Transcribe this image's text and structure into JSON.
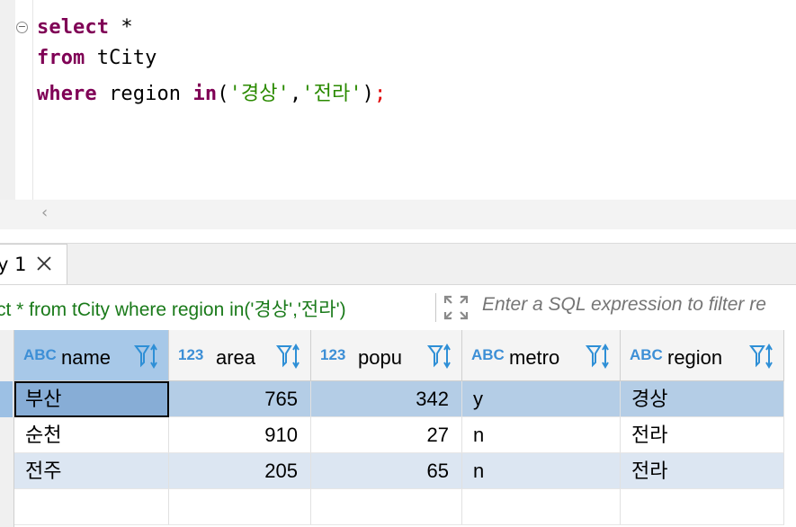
{
  "editor": {
    "line1": {
      "kw": "select",
      "rest": " *"
    },
    "line2": {
      "kw": "from",
      "rest": " tCity"
    },
    "line3": {
      "kw1": "where",
      "mid": " region ",
      "kw2": "in",
      "open": "(",
      "s1": "'경상'",
      "comma": ",",
      "s2": "'전라'",
      "close": ")",
      "semi": ";"
    }
  },
  "results_tab": {
    "label": "y 1"
  },
  "filter_bar": {
    "query": "ct * from tCity where region in('경상','전라')",
    "placeholder": "Enter a SQL expression to filter re"
  },
  "grid": {
    "columns": [
      {
        "type": "ABC",
        "name": "name"
      },
      {
        "type": "123",
        "name": "area"
      },
      {
        "type": "123",
        "name": "popu"
      },
      {
        "type": "ABC",
        "name": "metro"
      },
      {
        "type": "ABC",
        "name": "region"
      }
    ],
    "rows": [
      {
        "name": "부산",
        "area": "765",
        "popu": "342",
        "metro": "y",
        "region": "경상"
      },
      {
        "name": "순천",
        "area": "910",
        "popu": "27",
        "metro": "n",
        "region": "전라"
      },
      {
        "name": "전주",
        "area": "205",
        "popu": "65",
        "metro": "n",
        "region": "전라"
      }
    ]
  },
  "colors": {
    "keyword": "#7f0055",
    "string": "#2a8a00",
    "selection": "#b4cde6",
    "type_badge": "#3d8fd6"
  }
}
